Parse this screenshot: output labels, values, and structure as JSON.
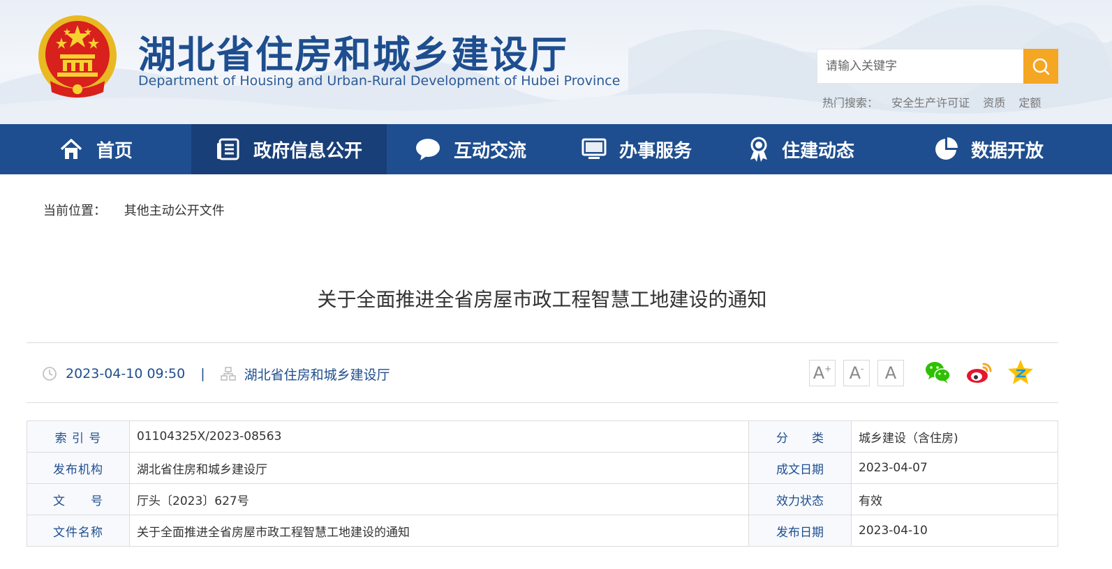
{
  "header": {
    "title": "湖北省住房和城乡建设厅",
    "subtitle": "Department of Housing and Urban-Rural Development of Hubei Province",
    "search_placeholder": "请输入关键字",
    "hot_label": "热门搜索：",
    "hot_items": [
      "安全生产许可证",
      "资质",
      "定额"
    ]
  },
  "nav": {
    "items": [
      {
        "label": "首页",
        "icon": "home-icon"
      },
      {
        "label": "政府信息公开",
        "icon": "document-list-icon"
      },
      {
        "label": "互动交流",
        "icon": "chat-bubble-icon"
      },
      {
        "label": "办事服务",
        "icon": "monitor-icon"
      },
      {
        "label": "住建动态",
        "icon": "award-ribbon-icon"
      },
      {
        "label": "数据开放",
        "icon": "pie-chart-icon"
      }
    ],
    "active_index": 1
  },
  "breadcrumb": {
    "label": "当前位置：",
    "current": "其他主动公开文件"
  },
  "article": {
    "title": "关于全面推进全省房屋市政工程智慧工地建设的通知",
    "datetime": "2023-04-10 09:50",
    "separator": "|",
    "source": "湖北省住房和城乡建设厅"
  },
  "tools": {
    "font_larger": "A",
    "font_smaller": "A",
    "font_default": "A",
    "font_larger_mark": "+",
    "font_smaller_mark": "-"
  },
  "info": {
    "rows": [
      {
        "k1": "索 引 号",
        "v1": "01104325X/2023-08563",
        "k2": "分　　类",
        "v2": "城乡建设（含住房)"
      },
      {
        "k1": "发布机构",
        "v1": "湖北省住房和城乡建设厅",
        "k2": "成文日期",
        "v2": "2023-04-07"
      },
      {
        "k1": "文　　号",
        "v1": "厅头〔2023〕627号",
        "k2": "效力状态",
        "v2": "有效"
      },
      {
        "k1": "文件名称",
        "v1": "关于全面推进全省房屋市政工程智慧工地建设的通知",
        "k2": "发布日期",
        "v2": "2023-04-10"
      }
    ]
  },
  "colors": {
    "primary": "#1e4e8f",
    "nav_active": "#183f77",
    "search_button": "#f5a623"
  }
}
